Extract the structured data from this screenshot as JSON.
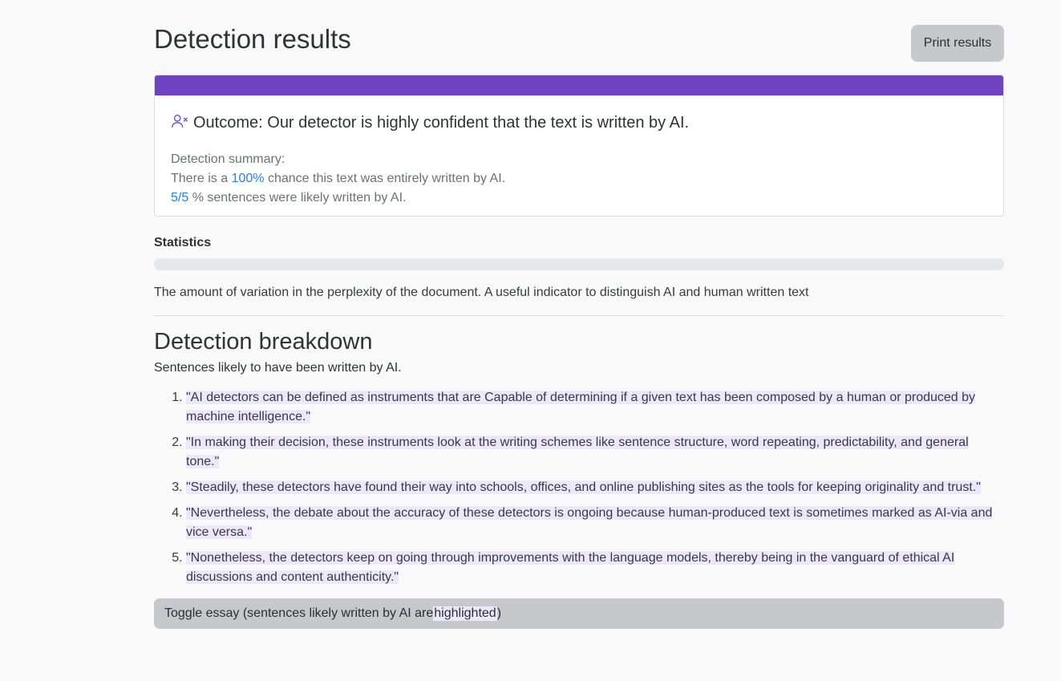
{
  "page": {
    "title": "Detection results",
    "print_label": "Print results"
  },
  "outcome": {
    "icon": "user-x-icon",
    "text": "Outcome: Our detector is highly confident that the text is written by AI."
  },
  "summary": {
    "heading": "Detection summary:",
    "line1_prefix": "There is a ",
    "line1_value": "100%",
    "line1_suffix": " chance this text was entirely written by AI.",
    "line2_value": "5/5",
    "line2_suffix": " % sentences were likely written by AI."
  },
  "statistics": {
    "label": "Statistics",
    "description": "The amount of variation in the perplexity of the document. A useful indicator to distinguish AI and human written text"
  },
  "breakdown": {
    "heading": "Detection breakdown",
    "subheading": "Sentences likely to have been written by AI.",
    "sentences": [
      "\"AI detectors can be defined as instruments that are Capable of determining if a given text has been composed by a human or produced by machine intelligence.\"",
      "\"In making their decision, these instruments look at the writing schemes like sentence structure, word repeating, predictability, and general tone.\"",
      "\"Steadily, these detectors have found their way into schools, offices, and online publishing sites as the tools for keeping originality and trust.\"",
      "\"Nevertheless, the debate about the accuracy of these detectors is ongoing because human-produced text is sometimes marked as AI-via and vice versa.\"",
      "\"Nonetheless, the detectors keep on going through improvements with the language models, thereby being in the vanguard of ethical AI discussions and content authenticity.\""
    ]
  },
  "toggle": {
    "prefix": "Toggle essay (sentences likely written by AI are ",
    "highlight": "highlighted",
    "suffix": ")"
  },
  "colors": {
    "accent": "#7043c3",
    "link": "#2b7fd4",
    "highlight": "#ece7fb"
  }
}
